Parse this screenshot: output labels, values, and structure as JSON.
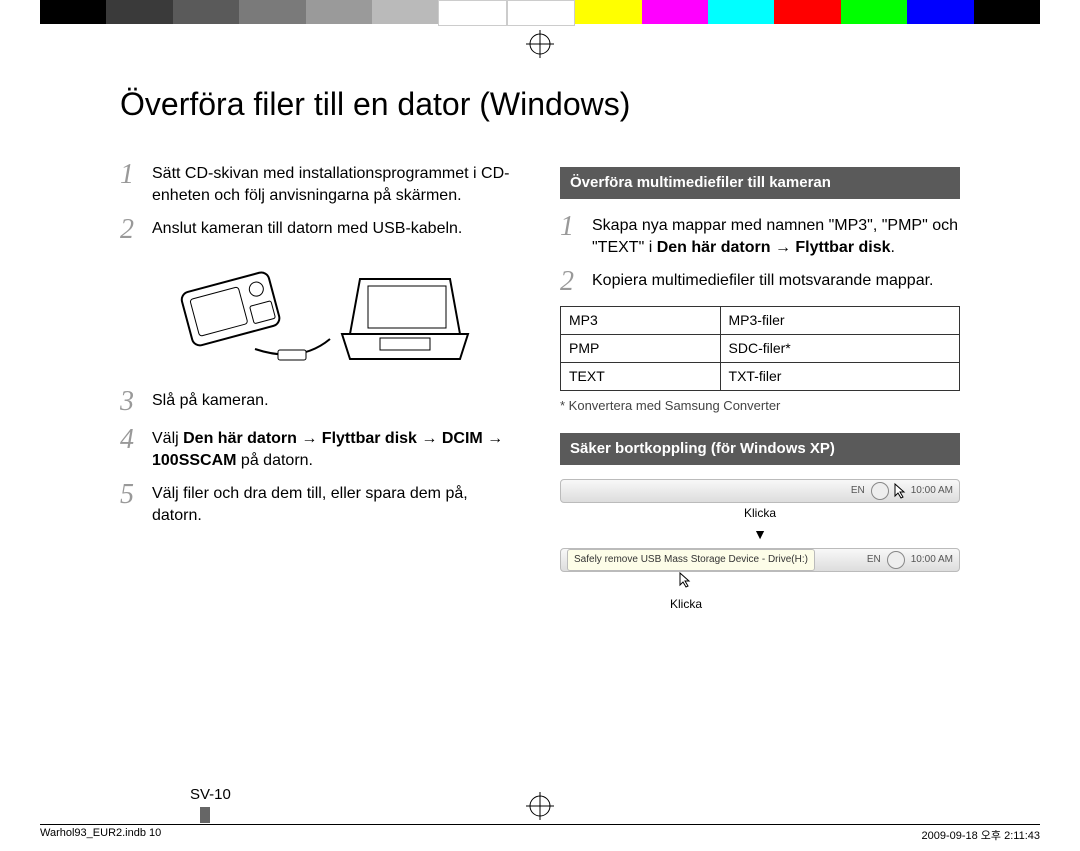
{
  "colorbar": [
    "#000",
    "#3a3a3a",
    "#5a5a5a",
    "#7a7a7a",
    "#9a9a9a",
    "#bababa",
    "#fff",
    "#fff",
    "#ffff00",
    "#ff00ff",
    "#00ffff",
    "#ff0000",
    "#00ff00",
    "#0000ff",
    "#000"
  ],
  "title": "Överföra filer till en dator (Windows)",
  "left": {
    "steps": [
      {
        "n": "1",
        "text": "Sätt CD-skivan med installationsprogrammet i CD-enheten och följ anvisningarna på skärmen."
      },
      {
        "n": "2",
        "text": "Anslut kameran till datorn med USB-kabeln."
      },
      {
        "n": "3",
        "text": "Slå på kameran."
      },
      {
        "n": "4",
        "prefix": "Välj ",
        "bold": "Den här datorn → Flyttbar disk → DCIM → 100SSCAM",
        "suffix": " på datorn."
      },
      {
        "n": "5",
        "text": "Välj filer och dra dem till, eller spara dem på, datorn."
      }
    ]
  },
  "right": {
    "section1": {
      "head": "Överföra multimediefiler till kameran",
      "steps": [
        {
          "n": "1",
          "prefix": "Skapa nya mappar med namnen \"MP3\", \"PMP\" och \"TEXT\" i ",
          "bold": "Den här datorn → Flyttbar disk",
          "suffix": "."
        },
        {
          "n": "2",
          "text": "Kopiera multimediefiler till motsvarande mappar."
        }
      ],
      "table": [
        {
          "a": "MP3",
          "b": "MP3-filer"
        },
        {
          "a": "PMP",
          "b": "SDC-filer*"
        },
        {
          "a": "TEXT",
          "b": "TXT-filer"
        }
      ],
      "footnote": "* Konvertera med Samsung Converter"
    },
    "section2": {
      "head": "Säker bortkoppling (för Windows XP)",
      "tb_lang": "EN",
      "tb_time": "10:00 AM",
      "klicka": "Klicka",
      "balloon": "Safely remove USB Mass Storage Device - Drive(H:)"
    }
  },
  "page_number": "SV-10",
  "print_left": "Warhol93_EUR2.indb   10",
  "print_right": "2009-09-18   오후 2:11:43"
}
